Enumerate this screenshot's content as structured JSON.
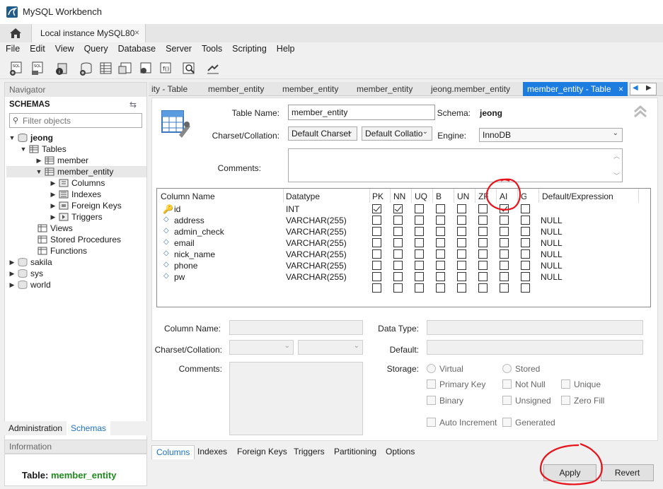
{
  "window": {
    "title": "MySQL Workbench"
  },
  "instance_tab": {
    "label": "Local instance MySQL80",
    "close": "×"
  },
  "menu": [
    "File",
    "Edit",
    "View",
    "Query",
    "Database",
    "Server",
    "Tools",
    "Scripting",
    "Help"
  ],
  "navigator": {
    "title": "Navigator",
    "schemas_label": "SCHEMAS",
    "filter_placeholder": "Filter objects",
    "tree": [
      {
        "label": "jeong",
        "bold": true
      },
      {
        "label": "Tables"
      },
      {
        "label": "member"
      },
      {
        "label": "member_entity"
      },
      {
        "label": "Columns"
      },
      {
        "label": "Indexes"
      },
      {
        "label": "Foreign Keys"
      },
      {
        "label": "Triggers"
      },
      {
        "label": "Views"
      },
      {
        "label": "Stored Procedures"
      },
      {
        "label": "Functions"
      },
      {
        "label": "sakila"
      },
      {
        "label": "sys"
      },
      {
        "label": "world"
      }
    ],
    "bottom_tabs": [
      "Administration",
      "Schemas"
    ],
    "info_title": "Information",
    "info_table_label": "Table:",
    "info_table_value": "member_entity"
  },
  "editor_tabs": [
    "ity - Table",
    "member_entity",
    "member_entity",
    "member_entity",
    "jeong.member_entity",
    "member_entity - Table"
  ],
  "editor_tab_close": "×",
  "table": {
    "name_label": "Table Name:",
    "name_value": "member_entity",
    "schema_label": "Schema:",
    "schema_value": "jeong",
    "charset_label": "Charset/Collation:",
    "charset_value": "Default Charset",
    "collation_value": "Default Collatio",
    "engine_label": "Engine:",
    "engine_value": "InnoDB",
    "comments_label": "Comments:"
  },
  "grid": {
    "headers": [
      "Column Name",
      "Datatype",
      "PK",
      "NN",
      "UQ",
      "B",
      "UN",
      "ZF",
      "AI",
      "G",
      "Default/Expression"
    ],
    "rows": [
      {
        "name": "id",
        "type": "INT",
        "flags": [
          1,
          1,
          0,
          0,
          0,
          0,
          1,
          0
        ],
        "default": "",
        "key": true
      },
      {
        "name": "address",
        "type": "VARCHAR(255)",
        "flags": [
          0,
          0,
          0,
          0,
          0,
          0,
          0,
          0
        ],
        "default": "NULL"
      },
      {
        "name": "admin_check",
        "type": "VARCHAR(255)",
        "flags": [
          0,
          0,
          0,
          0,
          0,
          0,
          0,
          0
        ],
        "default": "NULL"
      },
      {
        "name": "email",
        "type": "VARCHAR(255)",
        "flags": [
          0,
          0,
          0,
          0,
          0,
          0,
          0,
          0
        ],
        "default": "NULL"
      },
      {
        "name": "nick_name",
        "type": "VARCHAR(255)",
        "flags": [
          0,
          0,
          0,
          0,
          0,
          0,
          0,
          0
        ],
        "default": "NULL"
      },
      {
        "name": "phone",
        "type": "VARCHAR(255)",
        "flags": [
          0,
          0,
          0,
          0,
          0,
          0,
          0,
          0
        ],
        "default": "NULL"
      },
      {
        "name": "pw",
        "type": "VARCHAR(255)",
        "flags": [
          0,
          0,
          0,
          0,
          0,
          0,
          0,
          0
        ],
        "default": "NULL"
      },
      {
        "name": "",
        "type": "",
        "flags": [
          0,
          0,
          0,
          0,
          0,
          0,
          0,
          0
        ],
        "default": ""
      }
    ]
  },
  "details": {
    "column_name_label": "Column Name:",
    "data_type_label": "Data Type:",
    "charset_label": "Charset/Collation:",
    "default_label": "Default:",
    "comments_label": "Comments:",
    "storage_label": "Storage:",
    "virtual": "Virtual",
    "stored": "Stored",
    "primary_key": "Primary Key",
    "not_null": "Not Null",
    "unique": "Unique",
    "binary": "Binary",
    "unsigned": "Unsigned",
    "zero_fill": "Zero Fill",
    "auto_increment": "Auto Increment",
    "generated": "Generated"
  },
  "bottom_tabs": [
    "Columns",
    "Indexes",
    "Foreign Keys",
    "Triggers",
    "Partitioning",
    "Options"
  ],
  "buttons": {
    "apply": "Apply",
    "revert": "Revert"
  },
  "colors": {
    "accent": "#1c7ce0",
    "annotation": "#e8121a",
    "info_value": "#1e8a1e"
  }
}
